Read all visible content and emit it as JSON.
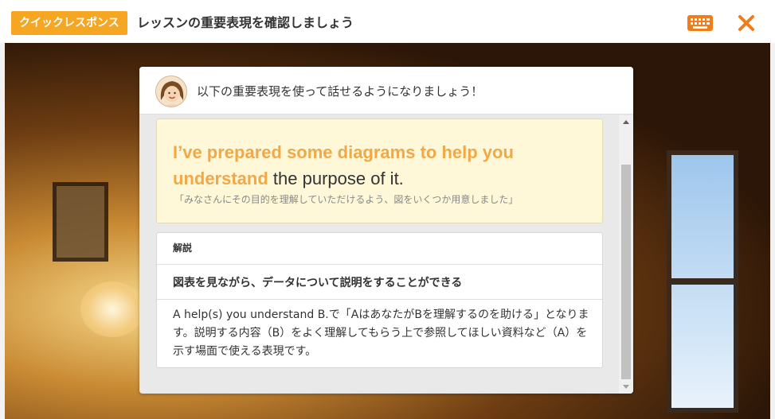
{
  "header": {
    "badge": "クイックレスポンス",
    "title": "レッスンの重要表現を確認しましょう",
    "keyboard_icon": "keyboard-icon",
    "close_icon": "close-icon",
    "accent_color": "#f5a623"
  },
  "panel": {
    "intro": "以下の重要表現を使って話せるようになりましょう！",
    "phrase": {
      "highlight": "I’ve prepared some diagrams to help you understand",
      "rest": " the purpose of it.",
      "translation": "「みなさんにその目的を理解していただけるよう、図をいくつか用意しました」",
      "highlight_color": "#f0a848"
    },
    "explanation": {
      "label": "解説",
      "heading": "図表を見ながら、データについて説明をすることができる",
      "body": "A help(s) you understand B.で「AはあなたがBを理解するのを助ける」となります。説明する内容（B）をよく理解してもらう上で参照してほしい資料など（A）を示す場面で使える表現です。"
    }
  }
}
